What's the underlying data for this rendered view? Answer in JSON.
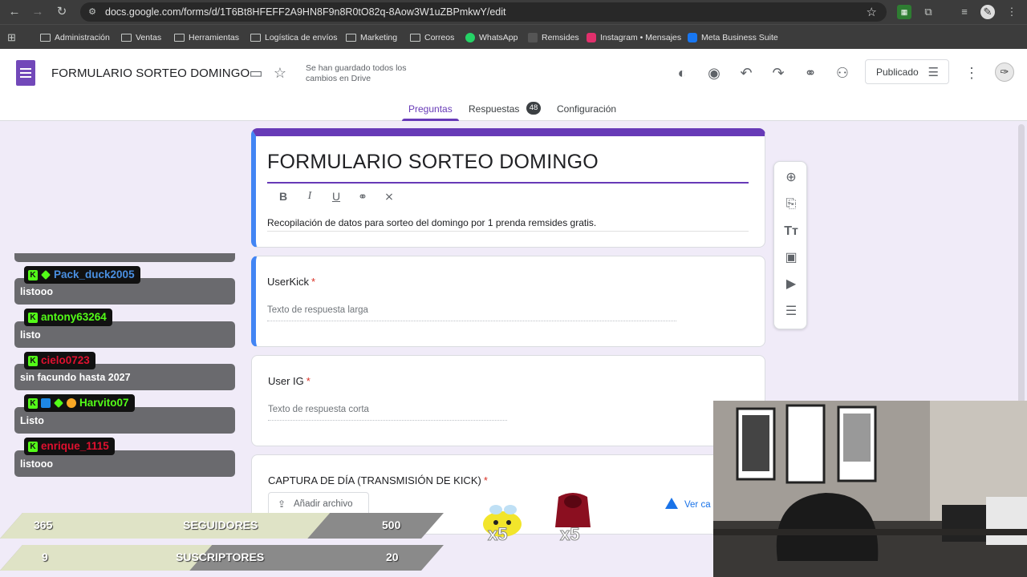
{
  "browser": {
    "url": "docs.google.com/forms/d/1T6Bt8HFEFF2A9HN8F9n8R0tO82q-8Aow3W1uZBPmkwY/edit",
    "bookmarks": [
      {
        "label": "Administración",
        "icon": "folder-icon"
      },
      {
        "label": "Ventas",
        "icon": "folder-icon"
      },
      {
        "label": "Herramientas",
        "icon": "folder-icon"
      },
      {
        "label": "Logística de envíos",
        "icon": "folder-icon"
      },
      {
        "label": "Marketing",
        "icon": "folder-icon"
      },
      {
        "label": "Correos",
        "icon": "folder-icon"
      },
      {
        "label": "WhatsApp",
        "icon": "whatsapp-icon"
      },
      {
        "label": "Remsides",
        "icon": "remsides-icon"
      },
      {
        "label": "Instagram • Mensajes",
        "icon": "instagram-icon"
      },
      {
        "label": "Meta Business Suite",
        "icon": "meta-icon"
      }
    ]
  },
  "forms_header": {
    "doc_title": "FORMULARIO SORTEO DOMINGO",
    "save_status": "Se han guardado todos los cambios en Drive",
    "publish_label": "Publicado",
    "tabs": [
      {
        "label": "Preguntas"
      },
      {
        "label": "Respuestas"
      },
      {
        "label": "Configuración"
      }
    ],
    "responses_count": "48"
  },
  "form": {
    "title": "FORMULARIO SORTEO DOMINGO",
    "description": "Recopilación de datos para sorteo del domingo por 1 prenda remsides gratis.",
    "questions": [
      {
        "title": "UserKick",
        "required_mark": "*",
        "answer_placeholder": "Texto de respuesta larga"
      },
      {
        "title": "User IG",
        "required_mark": "*",
        "answer_placeholder": "Texto de respuesta corta"
      },
      {
        "title": "CAPTURA DE DÍA (TRANSMISIÓN DE KICK)",
        "required_mark": "*",
        "upload_label": "Añadir archivo",
        "drive_link": "Ver ca"
      }
    ]
  },
  "chat": {
    "messages": [
      {
        "user": "Pack_duck2005",
        "user_color": "#4a90e2",
        "text": "listooo"
      },
      {
        "user": "antony63264",
        "user_color": "#53fc18",
        "text": "listo"
      },
      {
        "user": "cielo0723",
        "user_color": "#e0102f",
        "text": "sin facundo hasta 2027"
      },
      {
        "user": "Harvito07",
        "user_color": "#53fc18",
        "text": "Listo"
      },
      {
        "user": "enrique_1115",
        "user_color": "#e0102f",
        "text": "listooo"
      }
    ]
  },
  "stats": {
    "followers": {
      "current": "365",
      "label": "SEGUIDORES",
      "goal": "500",
      "progress": 0.73
    },
    "subscribers": {
      "current": "9",
      "label": "SUSCRIPTORES",
      "goal": "20",
      "progress": 0.45
    }
  },
  "stickers": [
    {
      "name": "bee-sticker",
      "multiplier": "x5"
    },
    {
      "name": "hoodie-sticker",
      "multiplier": "x5"
    }
  ],
  "colors": {
    "forms_purple": "#673ab7",
    "kick_green": "#53fc18",
    "link_blue": "#1a73e8"
  }
}
